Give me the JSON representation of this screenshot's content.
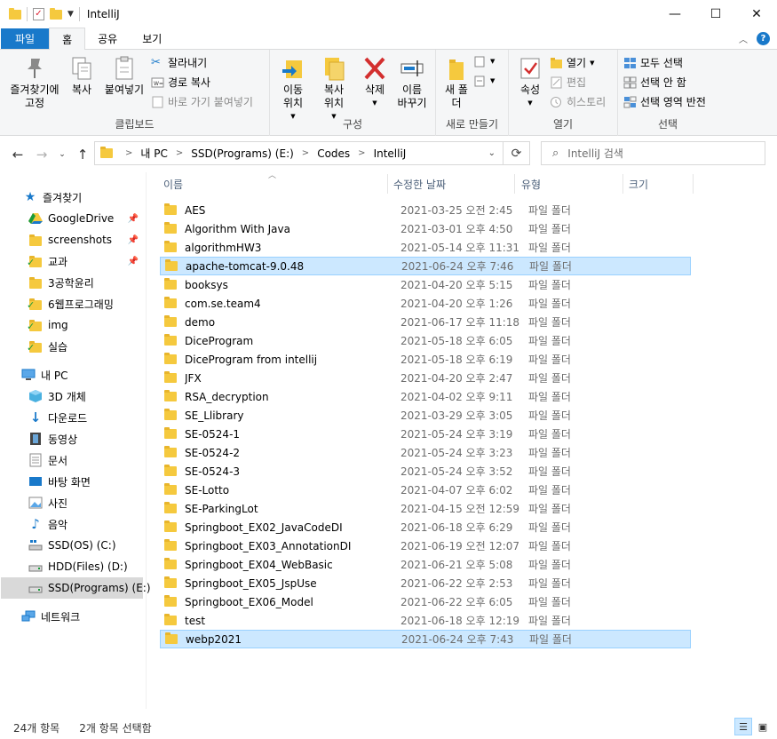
{
  "window": {
    "title": "IntelliJ",
    "minimize": "—",
    "maximize": "☐",
    "close": "✕"
  },
  "tabs": {
    "file": "파일",
    "home": "홈",
    "share": "공유",
    "view": "보기"
  },
  "ribbon": {
    "clipboard": {
      "label": "클립보드",
      "pin": "즐겨찾기에 고정",
      "copy": "복사",
      "paste": "붙여넣기",
      "cut": "잘라내기",
      "copy_path": "경로 복사",
      "paste_shortcut": "바로 가기 붙여넣기"
    },
    "organize": {
      "label": "구성",
      "move_to": "이동 위치",
      "copy_to": "복사 위치",
      "delete": "삭제",
      "rename": "이름 바꾸기"
    },
    "new": {
      "label": "새로 만들기",
      "new_folder": "새 폴더"
    },
    "open": {
      "label": "열기",
      "properties": "속성",
      "open": "열기",
      "edit": "편집",
      "history": "히스토리"
    },
    "select": {
      "label": "선택",
      "select_all": "모두 선택",
      "select_none": "선택 안 함",
      "invert": "선택 영역 반전"
    }
  },
  "address": {
    "crumbs": [
      "내 PC",
      "SSD(Programs) (E:)",
      "Codes",
      "IntelliJ"
    ],
    "search_placeholder": "IntelliJ 검색"
  },
  "navpane": {
    "quick_access": "즐겨찾기",
    "pinned": [
      "GoogleDrive",
      "screenshots",
      "교과"
    ],
    "recent": [
      "3공학윤리",
      "6웹프로그래밍",
      "img",
      "실습"
    ],
    "this_pc": "내 PC",
    "pc_items": [
      "3D 개체",
      "다운로드",
      "동영상",
      "문서",
      "바탕 화면",
      "사진",
      "음악",
      "SSD(OS) (C:)",
      "HDD(Files) (D:)",
      "SSD(Programs) (E:)"
    ],
    "network": "네트워크"
  },
  "columns": {
    "name": "이름",
    "date": "수정한 날짜",
    "type": "유형",
    "size": "크기"
  },
  "files": [
    {
      "name": "AES",
      "date": "2021-03-25 오전 2:45",
      "type": "파일 폴더"
    },
    {
      "name": "Algorithm With Java",
      "date": "2021-03-01 오후 4:50",
      "type": "파일 폴더"
    },
    {
      "name": "algorithmHW3",
      "date": "2021-05-14 오후 11:31",
      "type": "파일 폴더"
    },
    {
      "name": "apache-tomcat-9.0.48",
      "date": "2021-06-24 오후 7:46",
      "type": "파일 폴더",
      "selected": true
    },
    {
      "name": "booksys",
      "date": "2021-04-20 오후 5:15",
      "type": "파일 폴더"
    },
    {
      "name": "com.se.team4",
      "date": "2021-04-20 오후 1:26",
      "type": "파일 폴더"
    },
    {
      "name": "demo",
      "date": "2021-06-17 오후 11:18",
      "type": "파일 폴더"
    },
    {
      "name": "DiceProgram",
      "date": "2021-05-18 오후 6:05",
      "type": "파일 폴더"
    },
    {
      "name": "DiceProgram from intellij",
      "date": "2021-05-18 오후 6:19",
      "type": "파일 폴더"
    },
    {
      "name": "JFX",
      "date": "2021-04-20 오후 2:47",
      "type": "파일 폴더"
    },
    {
      "name": "RSA_decryption",
      "date": "2021-04-02 오후 9:11",
      "type": "파일 폴더"
    },
    {
      "name": "SE_Llibrary",
      "date": "2021-03-29 오후 3:05",
      "type": "파일 폴더"
    },
    {
      "name": "SE-0524-1",
      "date": "2021-05-24 오후 3:19",
      "type": "파일 폴더"
    },
    {
      "name": "SE-0524-2",
      "date": "2021-05-24 오후 3:23",
      "type": "파일 폴더"
    },
    {
      "name": "SE-0524-3",
      "date": "2021-05-24 오후 3:52",
      "type": "파일 폴더"
    },
    {
      "name": "SE-Lotto",
      "date": "2021-04-07 오후 6:02",
      "type": "파일 폴더"
    },
    {
      "name": "SE-ParkingLot",
      "date": "2021-04-15 오전 12:59",
      "type": "파일 폴더"
    },
    {
      "name": "Springboot_EX02_JavaCodeDI",
      "date": "2021-06-18 오후 6:29",
      "type": "파일 폴더"
    },
    {
      "name": "Springboot_EX03_AnnotationDI",
      "date": "2021-06-19 오전 12:07",
      "type": "파일 폴더"
    },
    {
      "name": "Springboot_EX04_WebBasic",
      "date": "2021-06-21 오후 5:08",
      "type": "파일 폴더"
    },
    {
      "name": "Springboot_EX05_JspUse",
      "date": "2021-06-22 오후 2:53",
      "type": "파일 폴더"
    },
    {
      "name": "Springboot_EX06_Model",
      "date": "2021-06-22 오후 6:05",
      "type": "파일 폴더"
    },
    {
      "name": "test",
      "date": "2021-06-18 오후 12:19",
      "type": "파일 폴더"
    },
    {
      "name": "webp2021",
      "date": "2021-06-24 오후 7:43",
      "type": "파일 폴더",
      "selected": true
    }
  ],
  "status": {
    "item_count": "24개 항목",
    "selected_count": "2개 항목 선택함"
  },
  "colors": {
    "accent": "#1979ca",
    "selection": "#cce8ff",
    "selection_border": "#99d1ff",
    "folder": "#f5c93e"
  }
}
